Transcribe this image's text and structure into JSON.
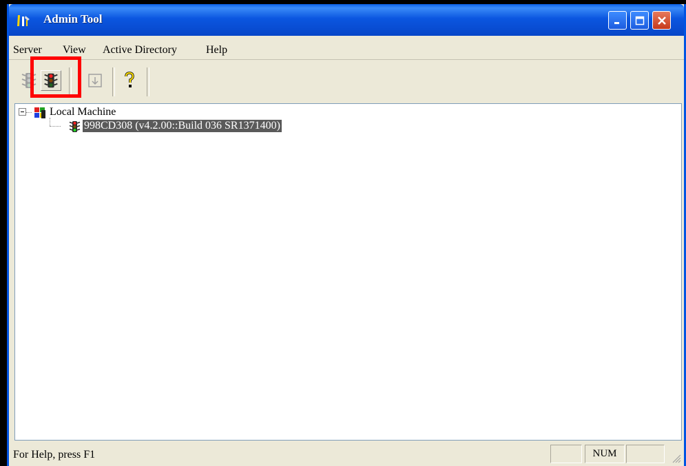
{
  "window": {
    "title": "Admin Tool"
  },
  "menu": {
    "items": [
      "Server",
      "View",
      "Active Directory",
      "Help"
    ]
  },
  "toolbar": {
    "buttons": [
      {
        "icon": "traffic-light-green-icon",
        "enabled": false
      },
      {
        "icon": "traffic-light-red-icon",
        "enabled": true
      },
      {
        "icon": "properties-icon",
        "enabled": false
      },
      {
        "icon": "help-icon",
        "enabled": true
      }
    ]
  },
  "tree": {
    "root": {
      "label": "Local Machine",
      "icon": "windows-logo-icon",
      "expanded": true
    },
    "children": [
      {
        "label": "998CD308 (v4.2.00::Build 036 SR1371400)",
        "icon": "traffic-light-icon",
        "selected": true
      }
    ]
  },
  "status": {
    "help_text": "For Help, press F1",
    "num": "NUM"
  },
  "colors": {
    "titlebar": "#0b56e0",
    "highlight": "#ff0000",
    "selection": "#5a5a5a"
  }
}
